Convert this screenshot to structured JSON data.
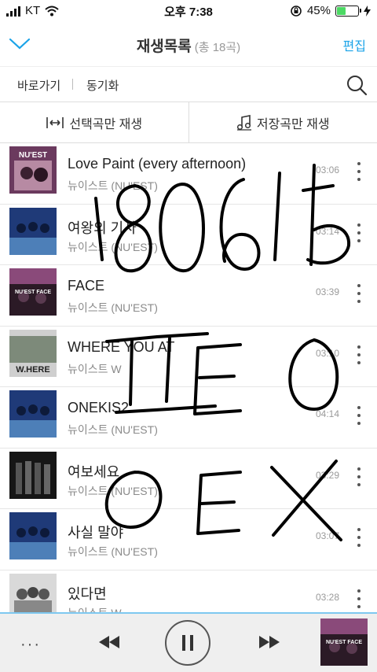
{
  "status_bar": {
    "carrier": "KT",
    "time": "오후 7:38",
    "battery": "45%",
    "battery_level": 0.45
  },
  "header": {
    "title": "재생목록",
    "count": "(총 18곡)",
    "edit_label": "편집"
  },
  "subnav": {
    "shortcut_label": "바로가기",
    "sync_label": "동기화"
  },
  "play_options": {
    "selected_label": "선택곡만 재생",
    "saved_label": "저장곡만 재생"
  },
  "songs": [
    {
      "title": "Love Paint (every afternoon)",
      "artist": "뉴이스트 (NU'EST)",
      "duration": "03:06"
    },
    {
      "title": "여왕의 기사",
      "artist": "뉴이스트 (NU'EST)",
      "duration": "03:14"
    },
    {
      "title": "FACE",
      "artist": "뉴이스트 (NU'EST)",
      "duration": "03:39"
    },
    {
      "title": "WHERE YOU AT",
      "artist": "뉴이스트 W",
      "duration": "03:10"
    },
    {
      "title": "ONEKIS2",
      "artist": "뉴이스트 (NU'EST)",
      "duration": "04:14"
    },
    {
      "title": "여보세요",
      "artist": "뉴이스트 (NU'EST)",
      "duration": "03:29"
    },
    {
      "title": "사실 말야",
      "artist": "뉴이스트 (NU'EST)",
      "duration": "03:07"
    },
    {
      "title": "있다면",
      "artist": "뉴이스트 W",
      "duration": "03:28"
    }
  ],
  "thumb_art_text": [
    "NU'EST",
    "",
    "NU'EST FACE",
    "W.HERE",
    "",
    "",
    "",
    ""
  ],
  "player": {
    "more_label": "···"
  },
  "colors": {
    "accent": "#1aa3e8",
    "player_bg": "#efefef",
    "progress": "#7ec8f0"
  }
}
